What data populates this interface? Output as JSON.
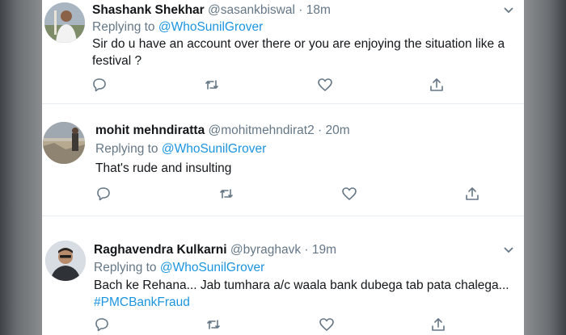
{
  "tweets": [
    {
      "name": "Shashank Shekhar",
      "handle": "@sasankbiswal",
      "separator": "·",
      "time": "18m",
      "replying_prefix": "Replying to",
      "replying_to": "@WhoSunilGrover",
      "text_line1": "Sir do u have an account over there or you are enjoying the situation like a",
      "text_line2": "festival ?"
    },
    {
      "name": "mohit mehndiratta",
      "handle": "@mohitmehndirat2",
      "separator": "·",
      "time": "20m",
      "replying_prefix": "Replying to",
      "replying_to": "@WhoSunilGrover",
      "text_line1": "That's rude and insulting"
    },
    {
      "name": "Raghavendra Kulkarni",
      "handle": "@byraghavk",
      "separator": "·",
      "time": "19m",
      "replying_prefix": "Replying to",
      "replying_to": "@WhoSunilGrover",
      "text_line1": "Bach ke Rehana... Jab tumhara a/c waala bank dubega tab pata chalega...",
      "hashtag": "#PMCBankFraud"
    }
  ],
  "icons": {
    "reply": "reply-icon",
    "retweet": "retweet-icon",
    "like": "like-icon",
    "share": "share-icon",
    "caret": "chevron-down-icon"
  },
  "colors": {
    "link": "#1b95e0",
    "secondary_text": "#657786",
    "primary_text": "#14171a",
    "divider": "#e6ecf0"
  }
}
